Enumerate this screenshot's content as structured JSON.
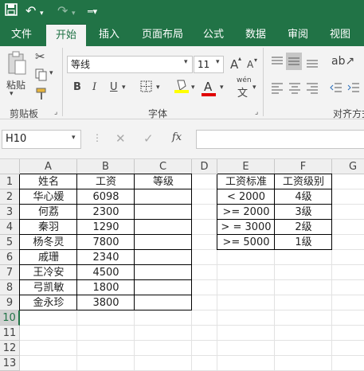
{
  "quick_access": {
    "save_icon": "save-icon",
    "undo_icon": "undo-icon",
    "redo_icon": "redo-icon",
    "customize_icon": "customize-icon"
  },
  "tabs": [
    "文件",
    "开始",
    "插入",
    "页面布局",
    "公式",
    "数据",
    "审阅",
    "视图"
  ],
  "active_tab": "开始",
  "clipboard": {
    "paste_label": "粘贴",
    "group_label": "剪贴板"
  },
  "font": {
    "name": "等线",
    "size": "11",
    "group_label": "字体",
    "bold": "B",
    "italic": "I",
    "underline": "U",
    "grow": "A",
    "shrink": "A",
    "wen": "wén",
    "wen2": "文"
  },
  "align": {
    "group_label": "对齐方式"
  },
  "formula_bar": {
    "name_box": "H10",
    "fx": "fx",
    "content": ""
  },
  "columns": [
    "A",
    "B",
    "C",
    "D",
    "E",
    "F",
    "G"
  ],
  "rows": [
    "1",
    "2",
    "3",
    "4",
    "5",
    "6",
    "7",
    "8",
    "9",
    "10",
    "11",
    "12",
    "13"
  ],
  "selected_row": "10",
  "main_table": {
    "headers": [
      "姓名",
      "工资",
      "等级"
    ],
    "rows": [
      [
        "华心媛",
        "6098",
        ""
      ],
      [
        "何荔",
        "2300",
        ""
      ],
      [
        "秦羽",
        "1290",
        ""
      ],
      [
        "杨冬灵",
        "7800",
        ""
      ],
      [
        "戚珊",
        "2340",
        ""
      ],
      [
        "王冷安",
        "4500",
        ""
      ],
      [
        "弓凯敏",
        "1800",
        ""
      ],
      [
        "金永珍",
        "3800",
        ""
      ]
    ]
  },
  "lookup_table": {
    "headers": [
      "工资标准",
      "工资级别"
    ],
    "rows": [
      [
        "< 2000",
        "4级"
      ],
      [
        ">= 2000",
        "3级"
      ],
      [
        "> = 3000",
        "2级"
      ],
      [
        ">= 5000",
        "1级"
      ]
    ]
  },
  "colors": {
    "brand": "#217346",
    "selected_header": "#217346"
  }
}
